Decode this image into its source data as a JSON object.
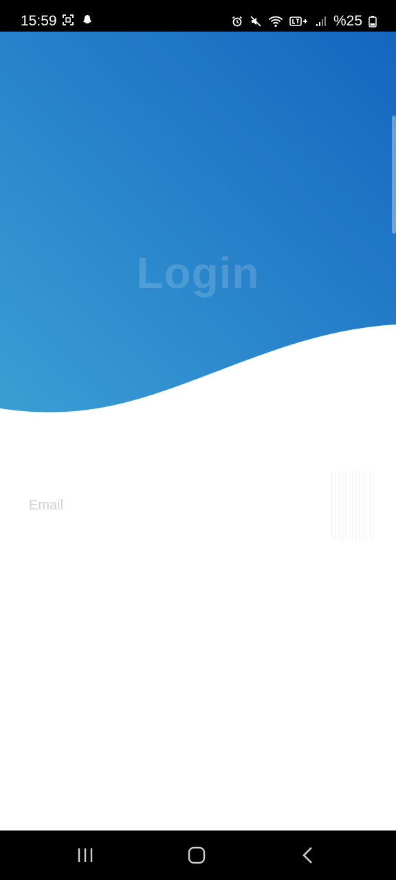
{
  "status_bar": {
    "time": "15:59",
    "battery": "%25",
    "left_icons": [
      "screenshot-icon",
      "snapchat-ghost-icon"
    ],
    "right_icons": [
      "alarm-icon",
      "mute-icon",
      "wifi-icon",
      "lte-icon",
      "signal-icon",
      "battery-icon"
    ]
  },
  "header": {
    "title": "Login",
    "gradient_start": "#3a9fd4",
    "gradient_end": "#1565c0"
  },
  "form": {
    "email_label": "Email",
    "email_value": ""
  },
  "nav_bar": {
    "buttons": [
      "recent-apps-icon",
      "home-icon",
      "back-icon"
    ]
  }
}
